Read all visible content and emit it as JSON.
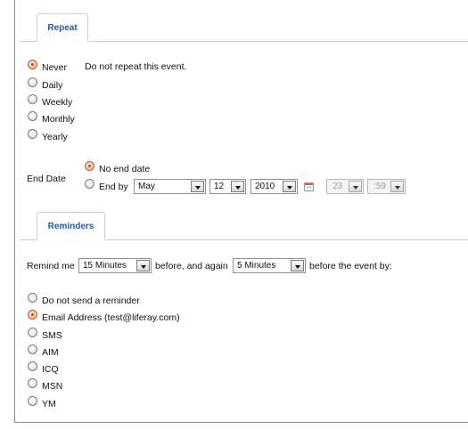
{
  "repeat": {
    "tab_label": "Repeat",
    "options": [
      {
        "label": "Never",
        "checked": true
      },
      {
        "label": "Daily",
        "checked": false
      },
      {
        "label": "Weekly",
        "checked": false
      },
      {
        "label": "Monthly",
        "checked": false
      },
      {
        "label": "Yearly",
        "checked": false
      }
    ],
    "description": "Do not repeat this event.",
    "end_date": {
      "label": "End Date",
      "no_end_label": "No end date",
      "no_end_checked": true,
      "end_by_label": "End by",
      "end_by_checked": false,
      "month": "May",
      "day": "12",
      "year": "2010",
      "hour": "23",
      "minute": ":59"
    }
  },
  "reminders": {
    "tab_label": "Reminders",
    "remind_me_label": "Remind me",
    "first_interval": "15 Minutes",
    "before_and_again_label": "before, and again",
    "second_interval": "5 Minutes",
    "before_event_label": "before the event by:",
    "options": [
      {
        "label": "Do not send a reminder",
        "checked": false
      },
      {
        "label": "Email Address (test@liferay.com)",
        "checked": true
      },
      {
        "label": "SMS",
        "checked": false
      },
      {
        "label": "AIM",
        "checked": false
      },
      {
        "label": "ICQ",
        "checked": false
      },
      {
        "label": "MSN",
        "checked": false
      },
      {
        "label": "YM",
        "checked": false
      }
    ]
  },
  "icons": {
    "calendar": "calendar-icon",
    "dropdown": "chevron-down-icon"
  },
  "colors": {
    "tab_text": "#1f5aa0",
    "radio_selected": "#c24d17"
  }
}
